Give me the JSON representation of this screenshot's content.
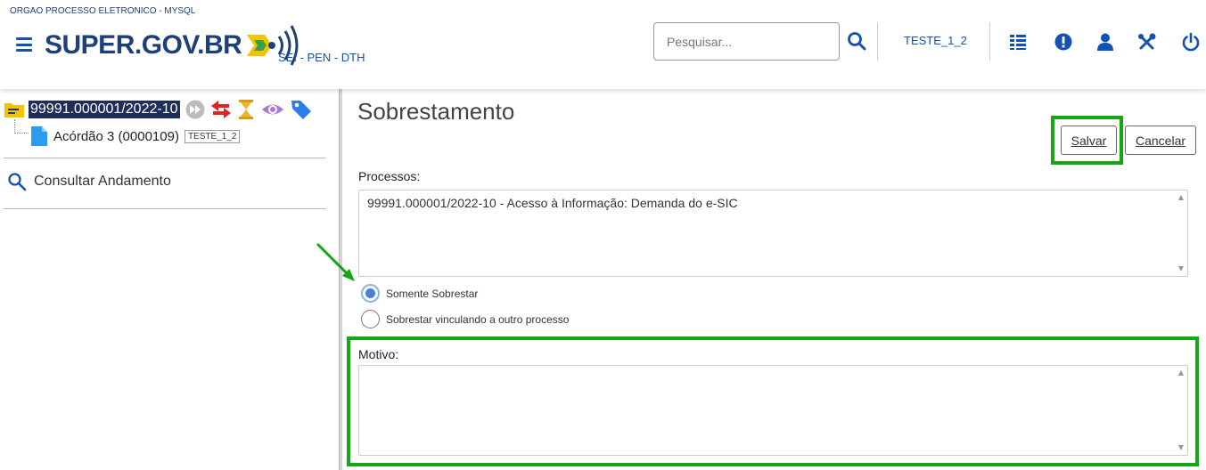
{
  "header": {
    "org_name": "ORGAO PROCESSO ELETRONICO - MYSQL",
    "logo_text": "SUPER.GOV.BR",
    "system_label": "SEI - PEN - DTH",
    "search_placeholder": "Pesquisar...",
    "user_label": "TESTE_1_2",
    "icons": [
      "menu-icon",
      "search-icon",
      "list-icon",
      "alert-icon",
      "user-icon",
      "tools-icon",
      "power-icon"
    ]
  },
  "sidebar": {
    "process_number": "99991.000001/2022-10",
    "process_icons": [
      "folder-icon",
      "forward-icon",
      "transfer-icon",
      "hourglass-icon",
      "eye-icon",
      "tag-icon"
    ],
    "document_label": "Acórdão 3 (0000109)",
    "document_user_tag": "TESTE_1_2",
    "consult_label": "Consultar Andamento"
  },
  "main": {
    "title": "Sobrestamento",
    "save_label": "Salvar",
    "cancel_label": "Cancelar",
    "processes_label": "Processos:",
    "processes_value": "99991.000001/2022-10 - Acesso à Informação: Demanda do e-SIC",
    "radio_options": [
      {
        "label": "Somente Sobrestar",
        "checked": true
      },
      {
        "label": "Sobrestar vinculando a outro processo",
        "checked": false
      }
    ],
    "motivo_label": "Motivo:",
    "motivo_value": ""
  },
  "colors": {
    "brand_blue": "#1351b4",
    "highlight_green": "#14a714",
    "selection_navy": "#1d2e5a"
  }
}
